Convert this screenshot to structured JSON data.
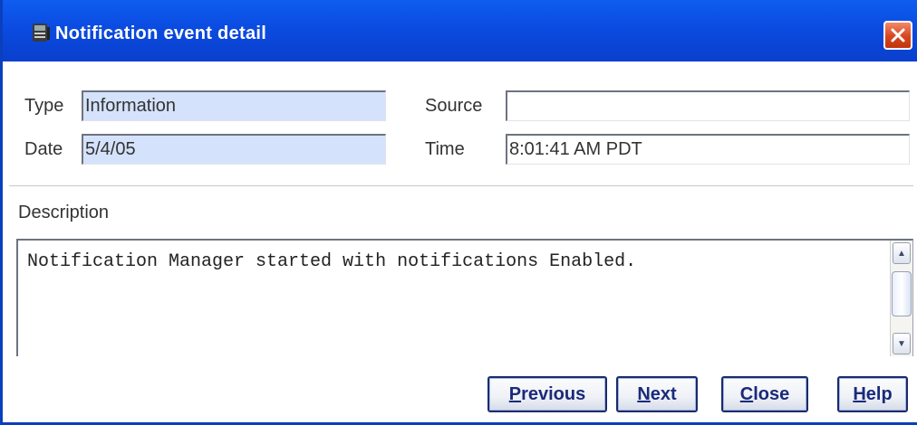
{
  "window": {
    "title": "Notification event detail",
    "close_glyph": "✕"
  },
  "fields": {
    "type_label": "Type",
    "type_value": "Information",
    "date_label": "Date",
    "date_value": "5/4/05",
    "source_label": "Source",
    "source_value": "",
    "time_label": "Time",
    "time_value": "8:01:41 AM PDT"
  },
  "description": {
    "label": "Description",
    "text": "Notification Manager started with notifications Enabled."
  },
  "buttons": {
    "previous_first": "P",
    "previous_rest": "revious",
    "next_first": "N",
    "next_rest": "ext",
    "close_first": "C",
    "close_rest": "lose",
    "help_first": "H",
    "help_rest": "elp"
  },
  "scrollbar": {
    "up_glyph": "▲",
    "down_glyph": "▼"
  },
  "colors": {
    "titlebar": "#0b4be0",
    "readonly_field": "#d5e2fb",
    "button_text": "#1a2a7a"
  }
}
